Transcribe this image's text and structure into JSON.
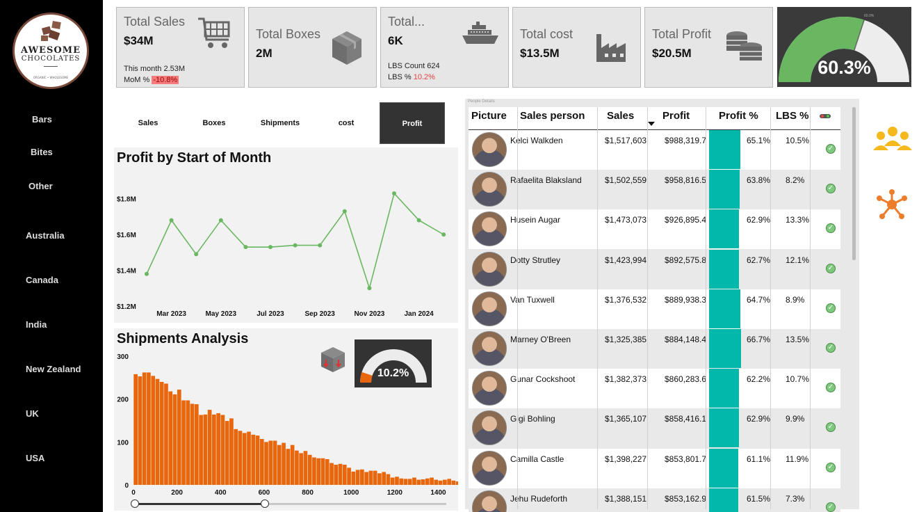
{
  "logo": {
    "line1": "AWESOME",
    "line2": "CHOCOLATES",
    "tagline": "ORGANIC • WHOLESOME"
  },
  "nav": {
    "categories": [
      "Bars",
      "Bites",
      "Other"
    ],
    "countries": [
      "Australia",
      "Canada",
      "India",
      "New Zealand",
      "UK",
      "USA"
    ]
  },
  "kpis": {
    "sales": {
      "label": "Total Sales",
      "value": "$34M",
      "line1": "This month 2.53M",
      "mom_label": "MoM %",
      "mom_value": "-10.8%"
    },
    "boxes": {
      "label": "Total Boxes",
      "value": "2M"
    },
    "shipments": {
      "label": "Total...",
      "value": "6K",
      "line1": "LBS Count 624",
      "lbs_label": "LBS %",
      "lbs_value": "10.2%"
    },
    "cost": {
      "label": "Total cost",
      "value": "$13.5M"
    },
    "profit": {
      "label": "Total Profit",
      "value": "$20.5M"
    }
  },
  "top_gauge": {
    "value": "60.3%",
    "fraction": 0.603,
    "target_label": "60.0%",
    "fill_color": "#6ab761",
    "bg_color": "#ededed"
  },
  "tabs": [
    "Sales",
    "Boxes",
    "Shipments",
    "cost",
    "Profit"
  ],
  "active_tab": "Profit",
  "line_chart_title": "Profit by Start of Month",
  "ship_title": "Shipments Analysis",
  "ship_gauge": {
    "value": "10.2%",
    "fraction": 0.102,
    "fill_color": "#e8660c"
  },
  "table": {
    "header_small": "People Details",
    "columns": [
      "Picture",
      "Sales person",
      "Sales",
      "Profit",
      "Profit %",
      "LBS %"
    ],
    "rows": [
      {
        "name": "Kelci Walkden",
        "sales": "$1,517,603",
        "profit": "$988,319.7",
        "pct": "65.1%",
        "lbs": "10.5%"
      },
      {
        "name": "Rafaelita Blaksland",
        "sales": "$1,502,559",
        "profit": "$958,816.5",
        "pct": "63.8%",
        "lbs": "8.2%"
      },
      {
        "name": "Husein Augar",
        "sales": "$1,473,073",
        "profit": "$926,895.4",
        "pct": "62.9%",
        "lbs": "13.3%"
      },
      {
        "name": "Dotty Strutley",
        "sales": "$1,423,994",
        "profit": "$892,575.8",
        "pct": "62.7%",
        "lbs": "12.1%"
      },
      {
        "name": "Van Tuxwell",
        "sales": "$1,376,532",
        "profit": "$889,938.3",
        "pct": "64.7%",
        "lbs": "8.9%"
      },
      {
        "name": "Marney O'Breen",
        "sales": "$1,325,385",
        "profit": "$884,148.4",
        "pct": "66.7%",
        "lbs": "13.5%"
      },
      {
        "name": "Gunar Cockshoot",
        "sales": "$1,382,373",
        "profit": "$860,283.6",
        "pct": "62.2%",
        "lbs": "10.7%"
      },
      {
        "name": "Gigi Bohling",
        "sales": "$1,365,107",
        "profit": "$858,416.1",
        "pct": "62.9%",
        "lbs": "9.9%"
      },
      {
        "name": "Camilla Castle",
        "sales": "$1,398,227",
        "profit": "$853,801.7",
        "pct": "61.1%",
        "lbs": "11.9%"
      },
      {
        "name": "Jehu Rudeforth",
        "sales": "$1,388,151",
        "profit": "$853,162.9",
        "pct": "61.5%",
        "lbs": "7.3%"
      }
    ]
  },
  "chart_data": [
    {
      "type": "line",
      "title": "Profit by Start of Month",
      "x": [
        "Feb 2023",
        "Mar 2023",
        "Apr 2023",
        "May 2023",
        "Jun 2023",
        "Jul 2023",
        "Aug 2023",
        "Sep 2023",
        "Oct 2023",
        "Nov 2023",
        "Dec 2023",
        "Jan 2024",
        "Feb 2024"
      ],
      "xtick_labels": [
        "Mar 2023",
        "May 2023",
        "Jul 2023",
        "Sep 2023",
        "Nov 2023",
        "Jan 2024"
      ],
      "values": [
        1.38,
        1.68,
        1.49,
        1.68,
        1.53,
        1.53,
        1.54,
        1.54,
        1.73,
        1.3,
        1.83,
        1.68,
        1.6
      ],
      "ytick_labels": [
        "$1.2M",
        "$1.4M",
        "$1.6M",
        "$1.8M"
      ],
      "ylim": [
        1.2,
        1.9
      ],
      "color": "#6ab761"
    },
    {
      "type": "bar",
      "title": "Shipments Analysis",
      "xlim": [
        0,
        1440
      ],
      "bin_width": 20,
      "xtick_labels": [
        "0",
        "200",
        "400",
        "600",
        "800",
        "1000",
        "1200",
        "1400"
      ],
      "ytick_labels": [
        "0",
        "100",
        "200",
        "300"
      ],
      "ylim": [
        0,
        300
      ],
      "color": "#e8660c",
      "values": [
        258,
        253,
        262,
        262,
        254,
        247,
        240,
        236,
        218,
        211,
        222,
        197,
        197,
        189,
        188,
        163,
        164,
        175,
        164,
        167,
        163,
        149,
        155,
        130,
        126,
        121,
        124,
        117,
        115,
        107,
        100,
        103,
        103,
        93,
        98,
        84,
        93,
        80,
        74,
        79,
        70,
        64,
        62,
        62,
        60,
        51,
        47,
        49,
        47,
        40,
        31,
        35,
        36,
        30,
        33,
        33,
        27,
        30,
        25,
        17,
        19,
        15,
        14,
        14,
        17,
        12,
        13,
        15,
        17,
        12,
        10,
        12,
        14,
        10,
        8,
        9,
        7,
        7,
        8,
        5
      ]
    }
  ],
  "slider": {
    "min": 0,
    "max": 1440,
    "range_start": 0,
    "range_end": 600
  }
}
